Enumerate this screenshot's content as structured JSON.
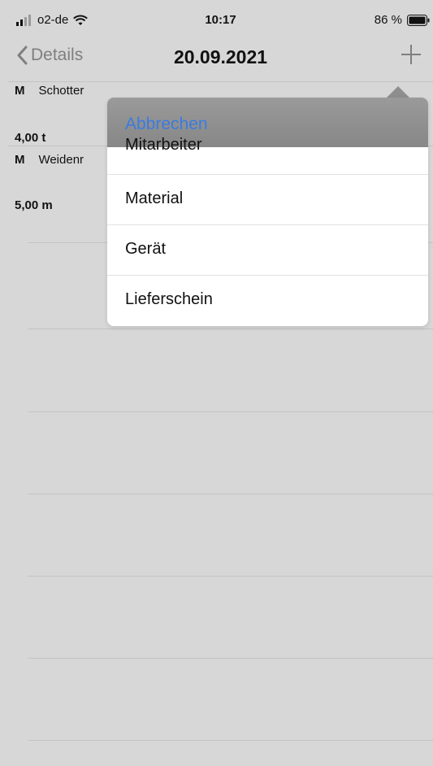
{
  "status": {
    "carrier": "o2-de",
    "time": "10:17",
    "battery": "86 %",
    "icons": {
      "signal": "signal-bars-icon",
      "wifi": "wifi-icon",
      "battery": "battery-icon"
    }
  },
  "nav": {
    "back_label": "Details",
    "title": "20.09.2021",
    "add_icon": "plus-icon"
  },
  "rows": [
    {
      "type": "M",
      "name": "Schotter",
      "quantity": "4,00 t"
    },
    {
      "type": "M",
      "name": "Weidenr",
      "quantity": "5,00 m"
    }
  ],
  "popover": {
    "cancel_label": "Abbrechen",
    "items": [
      {
        "label": "Mitarbeiter"
      },
      {
        "label": "Material"
      },
      {
        "label": "Gerät"
      },
      {
        "label": "Lieferschein"
      }
    ]
  },
  "colors": {
    "background": "#d7d7d7",
    "accent": "#3a7be0",
    "popover_header": "#8e8e8e",
    "separator": "#c3c3c3"
  }
}
